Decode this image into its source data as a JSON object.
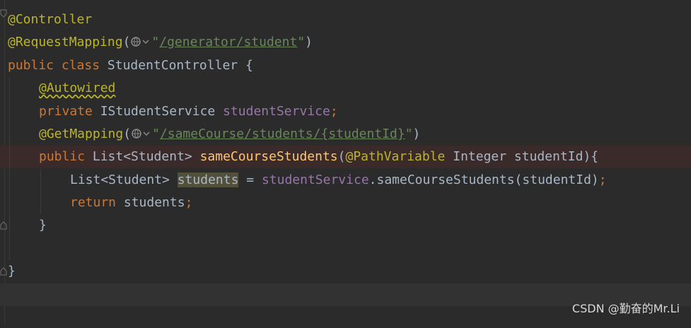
{
  "editor": {
    "language": "java",
    "lines": {
      "l1": {
        "ann": "@Controller"
      },
      "l2": {
        "ann": "@RequestMapping",
        "open": "(",
        "q1": "\"",
        "url": "/generator/student",
        "q2": "\"",
        "close": ")"
      },
      "l3": {
        "kw": "public class ",
        "name": "StudentController",
        "rest": " {"
      },
      "l4": {
        "ann": "@Autowired"
      },
      "l5": {
        "kw": "private ",
        "type": "IStudentService ",
        "field": "studentService",
        "semi": ";"
      },
      "l6": {
        "ann": "@GetMapping",
        "open": "(",
        "q1": "\"",
        "url1": "/sameCourse/students/",
        "url2": "{studentId}",
        "q2": "\"",
        "close": ")"
      },
      "l7": {
        "kw": "public ",
        "type": "List<Student> ",
        "method": "sameCourseStudents",
        "open": "(",
        "ann": "@PathVariable",
        "params": " Integer studentId){"
      },
      "l8": {
        "type": "List<Student> ",
        "var": "students",
        "eq": " = ",
        "field": "studentService",
        "call": ".sameCourseStudents(studentId)",
        "semi": ";"
      },
      "l9": {
        "kw": "return ",
        "var": "students",
        "semi": ";"
      },
      "l10": {
        "brace": "}"
      },
      "l11": {
        "brace": "}"
      }
    }
  },
  "watermark": "CSDN @勤奋的Mr.Li",
  "colors": {
    "background": "#2b2b2b",
    "keyword": "#cc7832",
    "annotation": "#bbb529",
    "string": "#6a8759",
    "field": "#9876aa",
    "method": "#ffc66d",
    "text": "#a9b7c6"
  }
}
